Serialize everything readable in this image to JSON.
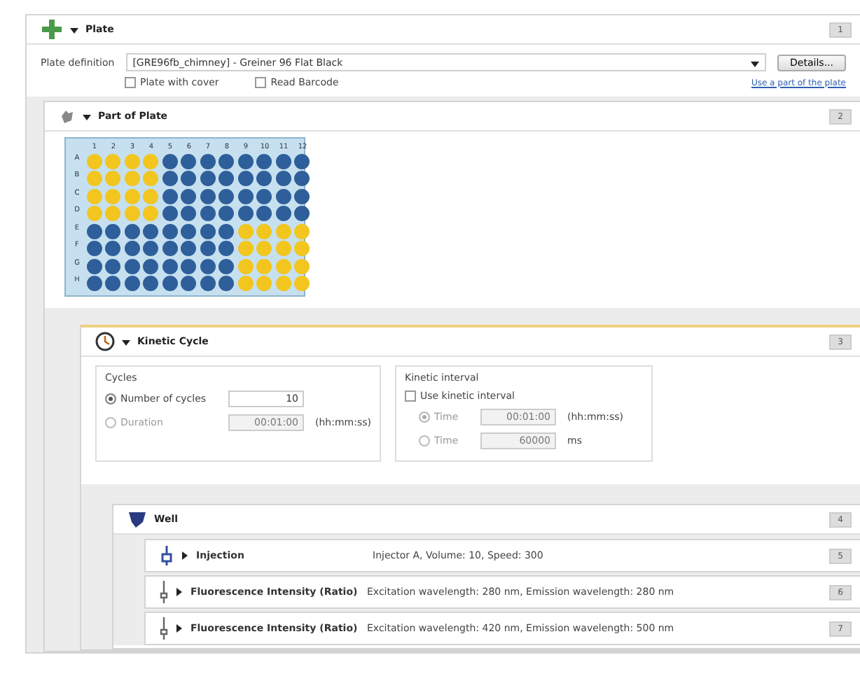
{
  "plate": {
    "title": "Plate",
    "number": "1",
    "expanded": true,
    "definition_label": "Plate definition",
    "definition_value": "[GRE96fb_chimney] - Greiner 96 Flat Black",
    "details_button": "Details...",
    "options": [
      {
        "label": "Plate with cover",
        "checked": false
      },
      {
        "label": "Read Barcode",
        "checked": false
      }
    ],
    "link": "Use a part of the plate"
  },
  "part_of_plate": {
    "title": "Part of Plate",
    "number": "2",
    "expanded": true,
    "columns": [
      "1",
      "2",
      "3",
      "4",
      "5",
      "6",
      "7",
      "8",
      "9",
      "10",
      "11",
      "12"
    ],
    "rows": [
      {
        "label": "A",
        "selected": [
          true,
          true,
          true,
          true,
          false,
          false,
          false,
          false,
          false,
          false,
          false,
          false
        ]
      },
      {
        "label": "B",
        "selected": [
          true,
          true,
          true,
          true,
          false,
          false,
          false,
          false,
          false,
          false,
          false,
          false
        ]
      },
      {
        "label": "C",
        "selected": [
          true,
          true,
          true,
          true,
          false,
          false,
          false,
          false,
          false,
          false,
          false,
          false
        ]
      },
      {
        "label": "D",
        "selected": [
          true,
          true,
          true,
          true,
          false,
          false,
          false,
          false,
          false,
          false,
          false,
          false
        ]
      },
      {
        "label": "E",
        "selected": [
          false,
          false,
          false,
          false,
          false,
          false,
          false,
          false,
          true,
          true,
          true,
          true
        ]
      },
      {
        "label": "F",
        "selected": [
          false,
          false,
          false,
          false,
          false,
          false,
          false,
          false,
          true,
          true,
          true,
          true
        ]
      },
      {
        "label": "G",
        "selected": [
          false,
          false,
          false,
          false,
          false,
          false,
          false,
          false,
          true,
          true,
          true,
          true
        ]
      },
      {
        "label": "H",
        "selected": [
          false,
          false,
          false,
          false,
          false,
          false,
          false,
          false,
          true,
          true,
          true,
          true
        ]
      }
    ]
  },
  "kinetic_cycle": {
    "title": "Kinetic Cycle",
    "number": "3",
    "expanded": true,
    "cycles": {
      "title": "Cycles",
      "options": [
        {
          "label": "Number of cycles",
          "selected": true,
          "value": "10",
          "disabled": false
        },
        {
          "label": "Duration",
          "selected": false,
          "value": "00:01:00",
          "unit": "(hh:mm:ss)",
          "disabled": true
        }
      ]
    },
    "interval": {
      "title": "Kinetic interval",
      "use_label": "Use kinetic interval",
      "checked": false,
      "options": [
        {
          "label": "Time",
          "selected": true,
          "value": "00:01:00",
          "unit": "(hh:mm:ss)",
          "disabled": true
        },
        {
          "label": "Time",
          "selected": false,
          "value": "60000",
          "unit": "ms",
          "disabled": true
        }
      ]
    }
  },
  "well": {
    "title": "Well",
    "number": "4"
  },
  "steps": [
    {
      "kind": "injection",
      "title": "Injection",
      "description": "Injector A, Volume: 10, Speed: 300",
      "number": "5",
      "expanded": false
    },
    {
      "kind": "fluorescence",
      "title": "Fluorescence Intensity (Ratio)",
      "description": "Excitation wavelength: 280 nm, Emission wavelength: 280 nm",
      "number": "6",
      "expanded": false
    },
    {
      "kind": "fluorescence",
      "title": "Fluorescence Intensity (Ratio)",
      "description": "Excitation wavelength: 420 nm, Emission wavelength: 500 nm",
      "number": "7",
      "expanded": false
    }
  ]
}
